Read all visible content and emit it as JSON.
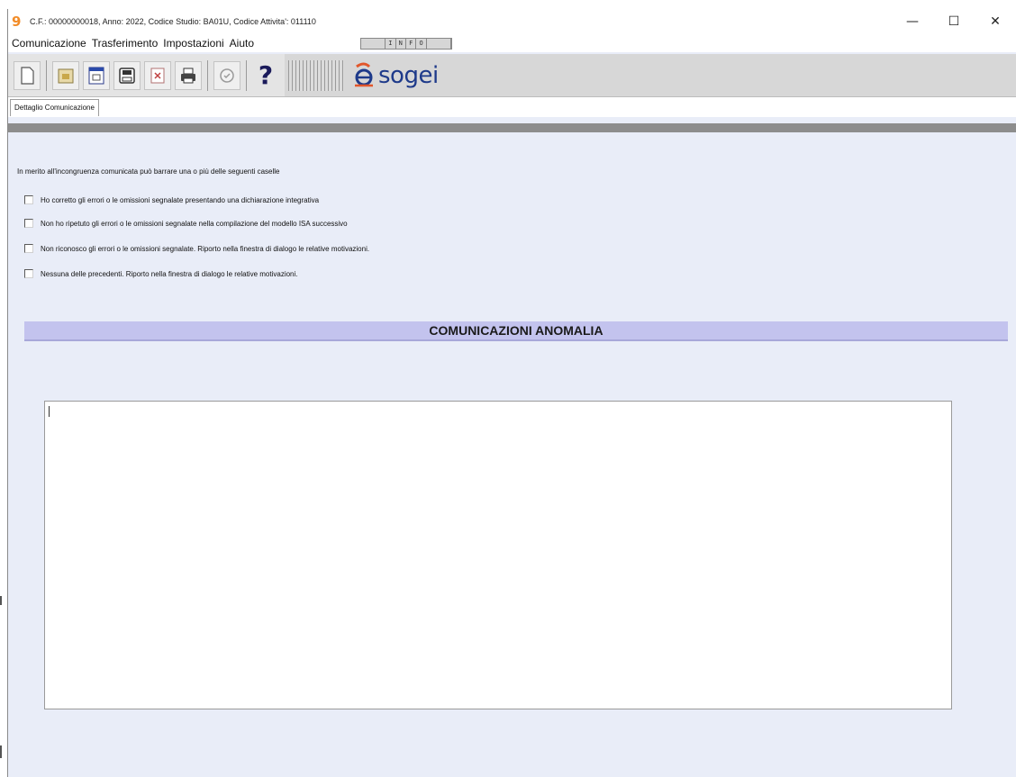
{
  "window": {
    "title": "C.F.: 00000000018, Anno: 2022, Codice Studio: BA01U, Codice Attivita': 011110",
    "app_icon_glyph": "9",
    "controls": {
      "minimize": "—",
      "maximize": "☐",
      "close": "✕"
    }
  },
  "menu": {
    "items": [
      "Comunicazione",
      "Trasferimento",
      "Impostazioni",
      "Aiuto"
    ],
    "mini_toolbar": [
      "",
      "I",
      "N",
      "F",
      "O",
      ""
    ]
  },
  "toolbar": {
    "buttons": [
      "new-document-icon",
      "open-folder-icon",
      "view-document-icon",
      "save-icon",
      "delete-icon",
      "print-icon",
      "check-icon"
    ],
    "help_label": "?",
    "logo_text": "sogei"
  },
  "tabs": {
    "active": "Dettaglio Comunicazione"
  },
  "form": {
    "intro": "In merito all'incongruenza comunicata può barrare una o più delle seguenti caselle",
    "options": [
      {
        "label": "Ho corretto gli errori o le omissioni segnalate presentando una dichiarazione integrativa",
        "checked": false
      },
      {
        "label": "Non ho ripetuto gli errori o le omissioni segnalate nella compilazione del modello ISA successivo",
        "checked": false
      },
      {
        "label": "Non riconosco gli errori o le omissioni segnalate. Riporto nella finestra di dialogo le relative motivazioni.",
        "checked": false
      },
      {
        "label": "Nessuna delle precedenti. Riporto nella finestra di dialogo le relative motivazioni.",
        "checked": false
      }
    ],
    "section_title": "COMUNICAZIONI ANOMALIA",
    "textarea_value": ""
  },
  "colors": {
    "window_bg": "#e9edf8",
    "section_header_bg": "#c3c3ee",
    "logo_blue": "#1e3a8a",
    "app_icon_orange": "#f28c28"
  }
}
